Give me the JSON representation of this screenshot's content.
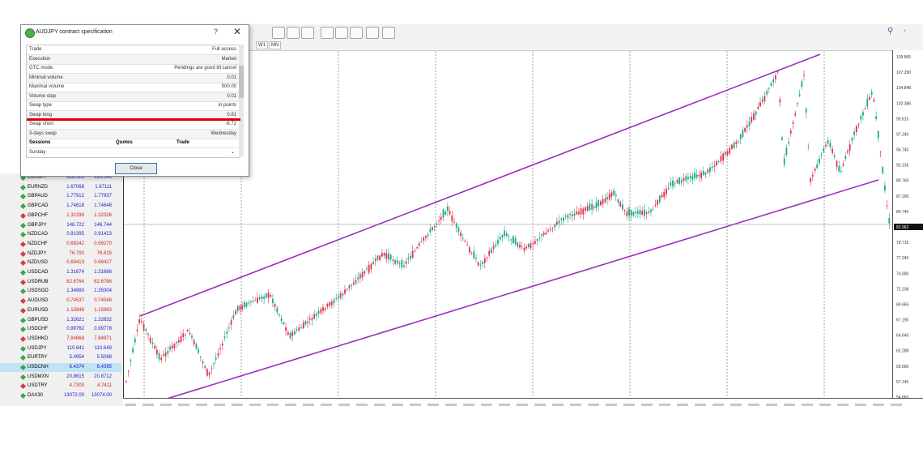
{
  "toolbar": {
    "timeframes": [
      "W1",
      "MN"
    ],
    "right_icons": [
      "search-icon",
      "chat-icon"
    ]
  },
  "dialog": {
    "title": "AUDJPY contract specification",
    "help": "?",
    "close": "✕",
    "rows": [
      {
        "k": "Trade",
        "v": "Full access"
      },
      {
        "k": "Execution",
        "v": "Market"
      },
      {
        "k": "GTC mode",
        "v": "Pendings are good till cancel"
      },
      {
        "k": "Minimal volume",
        "v": "0.01"
      },
      {
        "k": "Maximal volume",
        "v": "500.00"
      },
      {
        "k": "Volume step",
        "v": "0.01"
      },
      {
        "k": "Swap type",
        "v": "in points"
      },
      {
        "k": "Swap long",
        "v": "0.81"
      },
      {
        "k": "Swap short",
        "v": "-6.72"
      },
      {
        "k": "3-days swap",
        "v": "Wednesday"
      }
    ],
    "sessions_header": {
      "sessions": "Sessions",
      "quotes": "Quotes",
      "trade": "Trade"
    },
    "sessions_row": "Sunday",
    "close_button": "Close"
  },
  "market_watch": {
    "rows": [
      {
        "s": "EURJPY",
        "b": "128.523",
        "a": "128.540",
        "bc": "#1a1ad0",
        "ac": "#1a1ad0"
      },
      {
        "s": "EURNZD",
        "b": "1.67068",
        "a": "1.67111",
        "bc": "#1a1ad0",
        "ac": "#1a1ad0"
      },
      {
        "s": "GBPAUD",
        "b": "1.77912",
        "a": "1.77937",
        "bc": "#1a1ad0",
        "ac": "#1a1ad0"
      },
      {
        "s": "GBPCAD",
        "b": "1.74618",
        "a": "1.74648",
        "bc": "#1a1ad0",
        "ac": "#1a1ad0"
      },
      {
        "s": "GBPCHF",
        "b": "1.32298",
        "a": "1.32326",
        "bc": "#d02020",
        "ac": "#d02020"
      },
      {
        "s": "GBPJPY",
        "b": "146.722",
        "a": "146.744",
        "bc": "#1a1ad0",
        "ac": "#1a1ad0"
      },
      {
        "s": "NZDCAD",
        "b": "0.91395",
        "a": "0.91423",
        "bc": "#1a1ad0",
        "ac": "#1a1ad0"
      },
      {
        "s": "NZDCHF",
        "b": "0.69242",
        "a": "0.69270",
        "bc": "#d02020",
        "ac": "#d02020"
      },
      {
        "s": "NZDJPY",
        "b": "76.793",
        "a": "76.815",
        "bc": "#d02020",
        "ac": "#d02020"
      },
      {
        "s": "NZDUSD",
        "b": "0.69413",
        "a": "0.69427",
        "bc": "#d02020",
        "ac": "#d02020"
      },
      {
        "s": "USDCAD",
        "b": "1.31674",
        "a": "1.31686",
        "bc": "#1a1ad0",
        "ac": "#1a1ad0"
      },
      {
        "s": "USDRUB",
        "b": "62.6764",
        "a": "62.6766",
        "bc": "#d02020",
        "ac": "#d02020"
      },
      {
        "s": "USDSGD",
        "b": "1.34980",
        "a": "1.35004",
        "bc": "#1a1ad0",
        "ac": "#1a1ad0"
      },
      {
        "s": "AUDUSD",
        "b": "0.74537",
        "a": "0.74548",
        "bc": "#d02020",
        "ac": "#d02020"
      },
      {
        "s": "EURUSD",
        "b": "1.15946",
        "a": "1.15963",
        "bc": "#d02020",
        "ac": "#d02020"
      },
      {
        "s": "GBPUSD",
        "b": "1.32621",
        "a": "1.32632",
        "bc": "#1a1ad0",
        "ac": "#1a1ad0"
      },
      {
        "s": "USDCHF",
        "b": "0.99762",
        "a": "0.99778",
        "bc": "#1a1ad0",
        "ac": "#1a1ad0"
      },
      {
        "s": "USDHKD",
        "b": "7.84868",
        "a": "7.84971",
        "bc": "#d02020",
        "ac": "#d02020"
      },
      {
        "s": "USDJPY",
        "b": "110.641",
        "a": "110.649",
        "bc": "#1a1ad0",
        "ac": "#1a1ad0"
      },
      {
        "s": "EURTRY",
        "b": "5.4954",
        "a": "5.5088",
        "bc": "#1a1ad0",
        "ac": "#1a1ad0"
      },
      {
        "s": "USDCNH",
        "b": "6.4374",
        "a": "6.4395",
        "bc": "#1a1ad0",
        "ac": "#1a1ad0"
      },
      {
        "s": "USDMXN",
        "b": "20.8615",
        "a": "20.8712",
        "bc": "#1a1ad0",
        "ac": "#1a1ad0"
      },
      {
        "s": "USDTRY",
        "b": "4.7303",
        "a": "4.7411",
        "bc": "#d02020",
        "ac": "#d02020"
      },
      {
        "s": "DAX30",
        "b": "13072.00",
        "a": "13074.00",
        "bc": "#1a1ad0",
        "ac": "#1a1ad0"
      }
    ]
  },
  "chart": {
    "current_price": "82.962",
    "price_ticks": [
      "109.865",
      "107.290",
      "104.848",
      "102.386",
      "99.815",
      "97.240",
      "94.740",
      "92.316",
      "89.765",
      "87.290",
      "84.740",
      "82.962",
      "79.715",
      "77.240",
      "74.690",
      "72.238",
      "69.665",
      "67.190",
      "64.640",
      "62.288",
      "59.690",
      "57.140",
      "54.665"
    ]
  }
}
